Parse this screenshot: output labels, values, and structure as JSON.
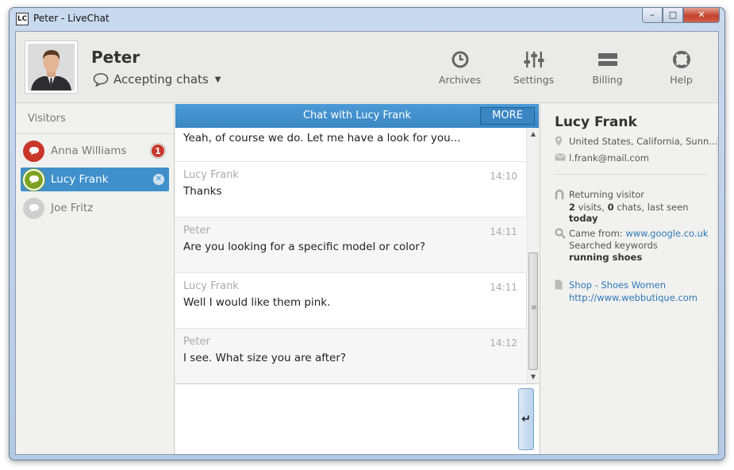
{
  "window": {
    "title": "Peter - LiveChat",
    "app_icon_text": "LC",
    "controls": [
      "–",
      "□",
      "✕"
    ]
  },
  "header": {
    "agent_name": "Peter",
    "status": "Accepting chats",
    "toolbar": [
      {
        "label": "Archives",
        "icon": "clock-icon"
      },
      {
        "label": "Settings",
        "icon": "sliders-icon"
      },
      {
        "label": "Billing",
        "icon": "card-icon"
      },
      {
        "label": "Help",
        "icon": "lifebuoy-icon"
      }
    ]
  },
  "sidebar": {
    "title": "Visitors",
    "visitors": [
      {
        "name": "Anna Williams",
        "badge": "1",
        "color": "#c8372a"
      },
      {
        "name": "Lucy Frank",
        "color": "#7ea21f"
      },
      {
        "name": "Joe Fritz",
        "color": "#cfcfcf"
      }
    ]
  },
  "chat": {
    "title": "Chat with Lucy Frank",
    "more_label": "MORE",
    "first_text": "Yeah, of course we do. Let me have a look for you...",
    "messages": [
      {
        "author": "Lucy Frank",
        "time": "14:10",
        "text": "Thanks"
      },
      {
        "author": "Peter",
        "time": "14:11",
        "text": "Are you looking for a specific model or color?"
      },
      {
        "author": "Lucy Frank",
        "time": "14:11",
        "text": "Well I would like them pink."
      },
      {
        "author": "Peter",
        "time": "14:12",
        "text": "I see. What size you are after?"
      }
    ],
    "send_symbol": "↵"
  },
  "details": {
    "name": "Lucy Frank",
    "location": "United States, California, Sunn...",
    "email": "l.frank@mail.com",
    "returning_label": "Returning visitor",
    "visits": "2",
    "visits_label": " visits, ",
    "chats": "0",
    "chats_label": " chats, last seen ",
    "last_seen": "today",
    "came_from_label": "Came from: ",
    "came_from_url": "www.google.co.uk",
    "keywords_label": "Searched keywords",
    "keywords": "running shoes",
    "page_title": "Shop - Shoes Women",
    "page_url": "http://www.webbutique.com"
  }
}
